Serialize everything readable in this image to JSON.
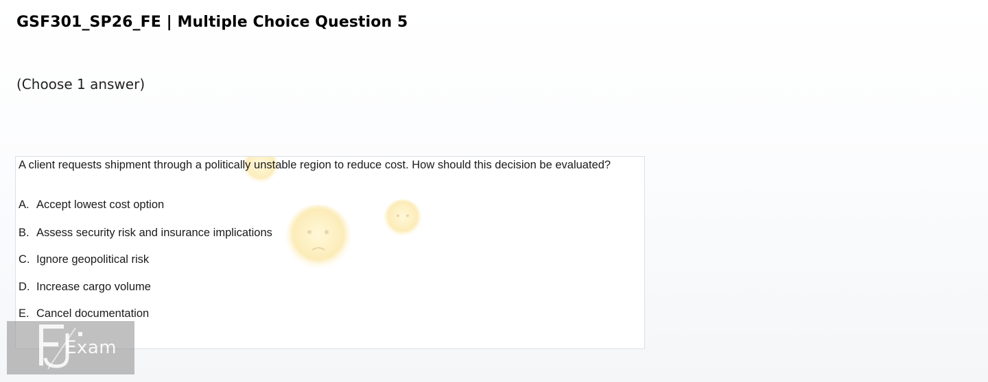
{
  "header": {
    "title": "GSF301_SP26_FE | Multiple Choice Question 5"
  },
  "instruction": "(Choose 1 answer)",
  "question": {
    "stem": "A client requests shipment through a politically unstable region to reduce cost. How should this decision be evaluated?",
    "options": [
      {
        "letter": "A.",
        "text": "Accept lowest cost option"
      },
      {
        "letter": "B.",
        "text": "Assess security risk and insurance implications"
      },
      {
        "letter": "C.",
        "text": "Ignore geopolitical risk"
      },
      {
        "letter": "D.",
        "text": "Increase cargo volume"
      },
      {
        "letter": "E.",
        "text": "Cancel documentation"
      }
    ]
  },
  "watermark": {
    "logo_text": "Exam",
    "logo_icon": "fu-logo-icon"
  }
}
